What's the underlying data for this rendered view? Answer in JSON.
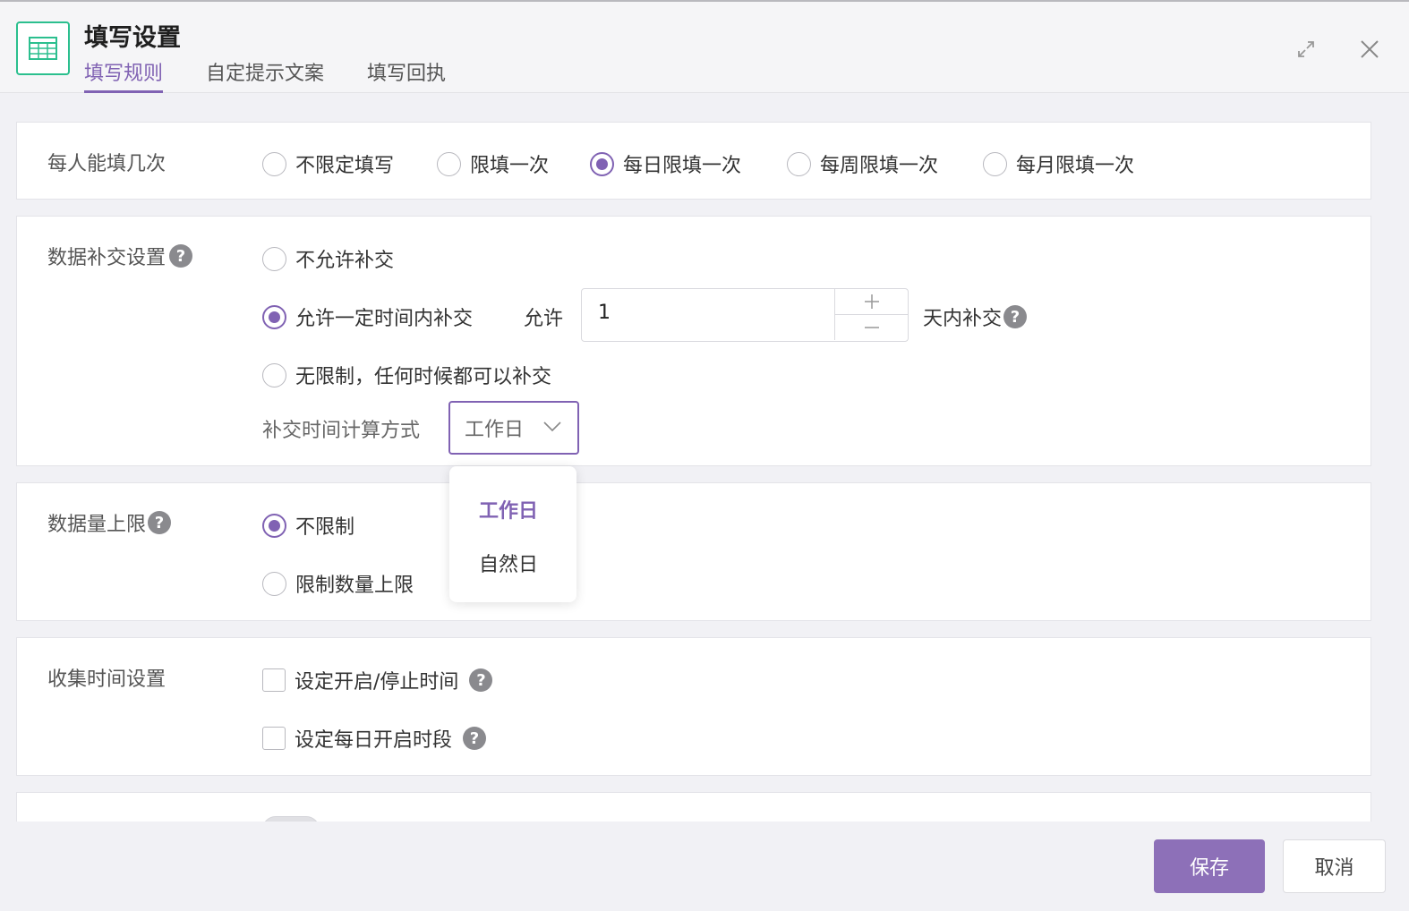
{
  "header": {
    "title": "填写设置",
    "tabs": [
      {
        "label": "填写规则",
        "active": true
      },
      {
        "label": "自定提示文案",
        "active": false
      },
      {
        "label": "填写回执",
        "active": false
      }
    ]
  },
  "fill_count": {
    "label": "每人能填几次",
    "options": [
      {
        "label": "不限定填写",
        "selected": false
      },
      {
        "label": "限填一次",
        "selected": false
      },
      {
        "label": "每日限填一次",
        "selected": true
      },
      {
        "label": "每周限填一次",
        "selected": false
      },
      {
        "label": "每月限填一次",
        "selected": false
      }
    ]
  },
  "resubmit": {
    "label": "数据补交设置",
    "options": [
      {
        "label": "不允许补交",
        "selected": false
      },
      {
        "label": "允许一定时间内补交",
        "selected": true
      },
      {
        "label": "无限制，任何时候都可以补交",
        "selected": false
      }
    ],
    "allow_prefix": "允许",
    "days_value": "1",
    "days_suffix": "天内补交",
    "calc_label": "补交时间计算方式",
    "calc_selected": "工作日",
    "calc_options": [
      "工作日",
      "自然日"
    ]
  },
  "data_limit": {
    "label": "数据量上限",
    "options": [
      {
        "label": "不限制",
        "selected": true
      },
      {
        "label": "限制数量上限",
        "selected": false
      }
    ]
  },
  "collect_time": {
    "label": "收集时间设置",
    "options": [
      {
        "label": "设定开启/停止时间",
        "checked": false
      },
      {
        "label": "设定每日开启时段",
        "checked": false
      }
    ]
  },
  "help_icon": "?",
  "footer": {
    "save": "保存",
    "cancel": "取消"
  },
  "colors": {
    "accent": "#8062b3",
    "icon_green": "#2bbf8e"
  }
}
